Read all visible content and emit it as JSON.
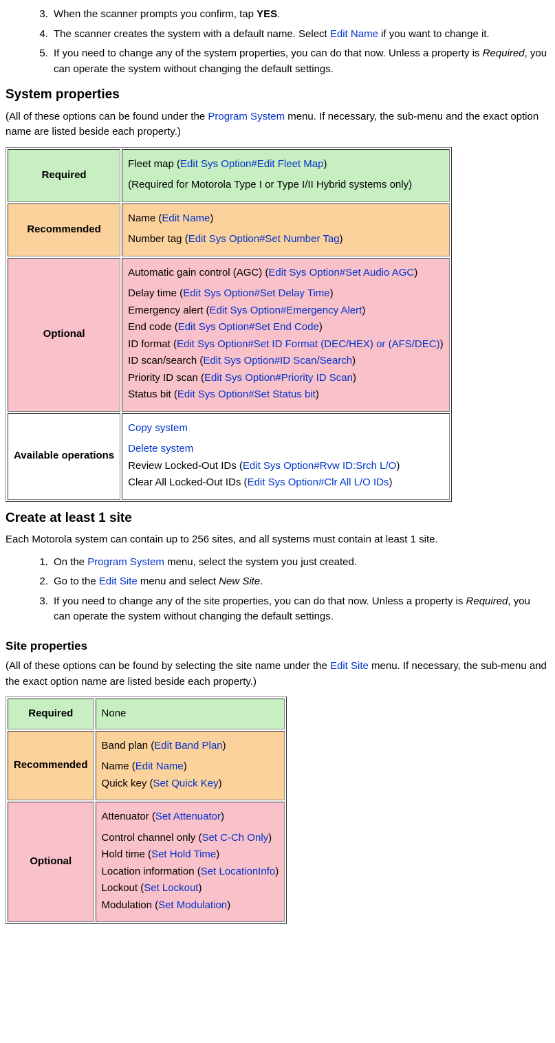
{
  "topList": {
    "item3": {
      "pre": "When the scanner prompts you confirm, tap ",
      "bold": "YES",
      "post": "."
    },
    "item4": {
      "pre": "The scanner creates the system with a default name. Select ",
      "link": "Edit Name",
      "post": " if you want to change it."
    },
    "item5": {
      "pre": "If you need to change any of the system properties, you can do that now. Unless a property is ",
      "em": "Required",
      "post": ", you can operate the system without changing the default settings."
    }
  },
  "sysProps": {
    "heading": "System properties",
    "intro_pre": "(All of these options can be found under the ",
    "intro_link": "Program System",
    "intro_post": " menu. If necessary, the sub-menu and the exact option name are listed beside each property.)",
    "rows": {
      "required": {
        "label": "Required",
        "line1_pre": "Fleet map (",
        "line1_link": "Edit Sys Option#Edit Fleet Map",
        "line1_post": ")",
        "line2": "(Required for Motorola Type I or Type I/II Hybrid systems only)"
      },
      "recommended": {
        "label": "Recommended",
        "nameLine_pre": "Name (",
        "nameLine_link": "Edit Name",
        "nameLine_post": ")",
        "numtag_pre": "Number tag (",
        "numtag_link": "Edit Sys Option#Set Number Tag",
        "numtag_post": ")"
      },
      "optional": {
        "label": "Optional",
        "agc_pre": "Automatic gain control (AGC) (",
        "agc_link": "Edit Sys Option#Set Audio AGC",
        "agc_post": ")",
        "delay_pre": "Delay time (",
        "delay_link": "Edit Sys Option#Set Delay Time",
        "delay_post": ")",
        "emerg_pre": "Emergency alert (",
        "emerg_link": "Edit Sys Option#Emergency Alert",
        "emerg_post": ")",
        "endcode_pre": "End code (",
        "endcode_link": "Edit Sys Option#Set End Code",
        "endcode_post": ")",
        "idfmt_pre": "ID format (",
        "idfmt_link": "Edit Sys Option#Set ID Format (DEC/HEX) or (AFS/DEC)",
        "idfmt_post": ")",
        "idscan_pre": "ID scan/search (",
        "idscan_link": "Edit Sys Option#ID Scan/Search",
        "idscan_post": ")",
        "priority_pre": "Priority ID scan (",
        "priority_link": "Edit Sys Option#Priority ID Scan",
        "priority_post": ")",
        "status_pre": "Status bit (",
        "status_link": "Edit Sys Option#Set Status bit",
        "status_post": ")"
      },
      "available": {
        "label": "Available operations",
        "copy": "Copy system",
        "delete": "Delete system",
        "review_pre": "Review Locked-Out IDs (",
        "review_link": "Edit Sys Option#Rvw ID:Srch L/O",
        "review_post": ")",
        "clear_pre": "Clear All Locked-Out IDs (",
        "clear_link": "Edit Sys Option#Clr All L/O IDs",
        "clear_post": ")"
      }
    }
  },
  "createSite": {
    "heading": "Create at least 1 site",
    "intro": "Each Motorola system can contain up to 256 sites, and all systems must contain at least 1 site.",
    "item1_pre": "On the ",
    "item1_link": "Program System",
    "item1_post": " menu, select the system you just created.",
    "item2_pre": "Go to the ",
    "item2_link": "Edit Site",
    "item2_mid": " menu and select ",
    "item2_em": "New Site",
    "item2_post": ".",
    "item3_pre": "If you need to change any of the site properties, you can do that now. Unless a property is ",
    "item3_em": "Required",
    "item3_post": ", you can operate the system without changing the default settings."
  },
  "siteProps": {
    "heading": "Site properties",
    "intro_pre": "(All of these options can be found by selecting the site name under the ",
    "intro_link": "Edit Site",
    "intro_post": " menu. If necessary, the sub-menu and the exact option name are listed beside each property.)",
    "rows": {
      "required": {
        "label": "Required",
        "value": "None"
      },
      "recommended": {
        "label": "Recommended",
        "band_pre": "Band plan (",
        "band_link": "Edit Band Plan",
        "band_post": ")",
        "name_pre": "Name (",
        "name_link": "Edit Name",
        "name_post": ")",
        "qk_pre": "Quick key (",
        "qk_link": "Set Quick Key",
        "qk_post": ")"
      },
      "optional": {
        "label": "Optional",
        "att_pre": "Attenuator (",
        "att_link": "Set Attenuator",
        "att_post": ")",
        "cch_pre": "Control channel only (",
        "cch_link": "Set C-Ch Only",
        "cch_post": ")",
        "hold_pre": "Hold time (",
        "hold_link": "Set Hold Time",
        "hold_post": ")",
        "loc_pre": "Location information (",
        "loc_link": "Set LocationInfo",
        "loc_post": ")",
        "lockout_pre": "Lockout (",
        "lockout_link": "Set Lockout",
        "lockout_post": ")",
        "mod_pre": "Modulation (",
        "mod_link": "Set Modulation",
        "mod_post": ")"
      }
    }
  }
}
